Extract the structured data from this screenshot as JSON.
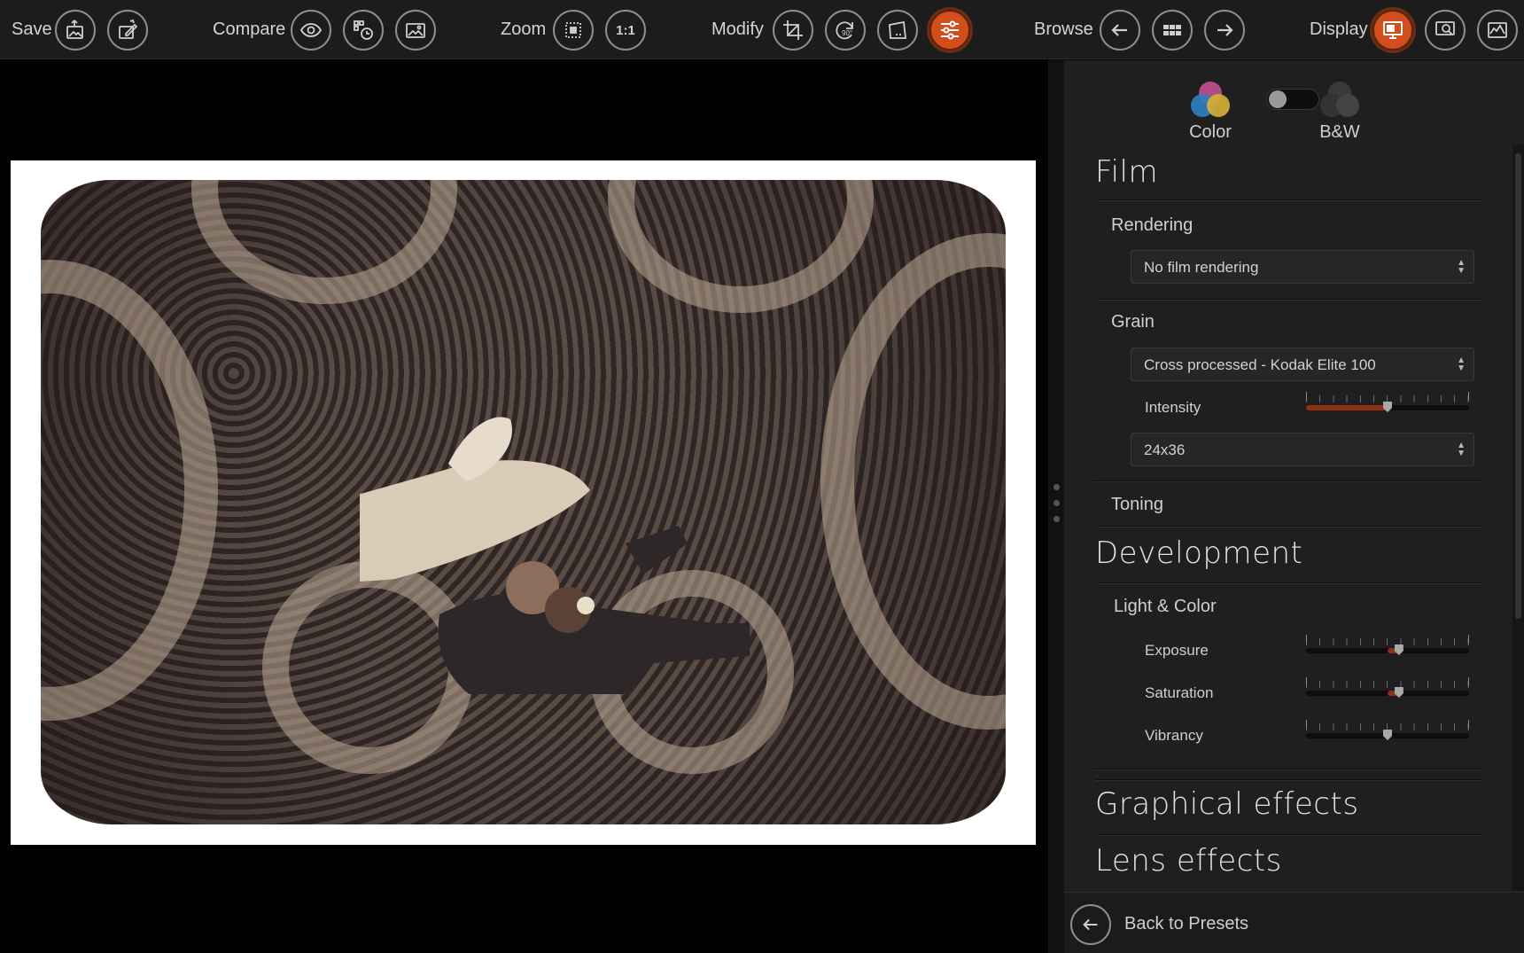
{
  "toolbar": {
    "save_label": "Save",
    "compare_label": "Compare",
    "zoom_label": "Zoom",
    "zoom_1to1": "1:1",
    "modify_label": "Modify",
    "rotate_label": "90°",
    "browse_label": "Browse",
    "display_label": "Display",
    "accent": "#d24e1c"
  },
  "mode": {
    "color_label": "Color",
    "bw_label": "B&W"
  },
  "film": {
    "title": "Film",
    "rendering_label": "Rendering",
    "rendering_value": "No film rendering",
    "grain_label": "Grain",
    "grain_value": "Cross processed - Kodak Elite 100",
    "intensity_label": "Intensity",
    "intensity_level": 0.5,
    "format_value": "24x36",
    "toning_label": "Toning"
  },
  "development": {
    "title": "Development",
    "light_color_label": "Light & Color",
    "exposure_label": "Exposure",
    "exposure_level": 0.57,
    "saturation_label": "Saturation",
    "saturation_level": 0.57,
    "vibrancy_label": "Vibrancy",
    "vibrancy_level": 0.5
  },
  "sections": {
    "graphical": "Graphical effects",
    "lens": "Lens effects"
  },
  "back_label": "Back to Presets"
}
